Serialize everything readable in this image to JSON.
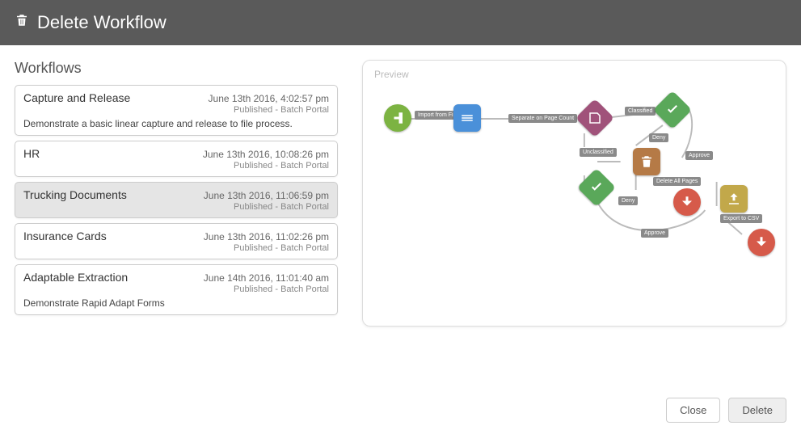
{
  "header": {
    "title": "Delete Workflow"
  },
  "sections": {
    "workflows_label": "Workflows",
    "preview_label": "Preview"
  },
  "workflows": [
    {
      "name": "Capture and Release",
      "date": "June 13th 2016, 4:02:57 pm",
      "status": "Published - Batch Portal",
      "desc": "Demonstrate a basic linear capture and release to file process.",
      "selected": false
    },
    {
      "name": "HR",
      "date": "June 13th 2016, 10:08:26 pm",
      "status": "Published - Batch Portal",
      "desc": "",
      "selected": false
    },
    {
      "name": "Trucking Documents",
      "date": "June 13th 2016, 11:06:59 pm",
      "status": "Published - Batch Portal",
      "desc": "",
      "selected": true
    },
    {
      "name": "Insurance Cards",
      "date": "June 13th 2016, 11:02:26 pm",
      "status": "Published - Batch Portal",
      "desc": "",
      "selected": false
    },
    {
      "name": "Adaptable Extraction",
      "date": "June 14th 2016, 11:01:40 am",
      "status": "Published - Batch Portal",
      "desc": "Demonstrate Rapid Adapt Forms",
      "selected": false
    }
  ],
  "diagram": {
    "labels": {
      "import": "Import from File",
      "separate": "Separate on Page Count",
      "classified": "Classified",
      "unclassified": "Unclassified",
      "deny1": "Deny",
      "approve1": "Approve",
      "delete_pages": "Delete All Pages",
      "deny2": "Deny",
      "approve2": "Approve",
      "export": "Export to CSV"
    }
  },
  "buttons": {
    "close": "Close",
    "delete": "Delete"
  }
}
